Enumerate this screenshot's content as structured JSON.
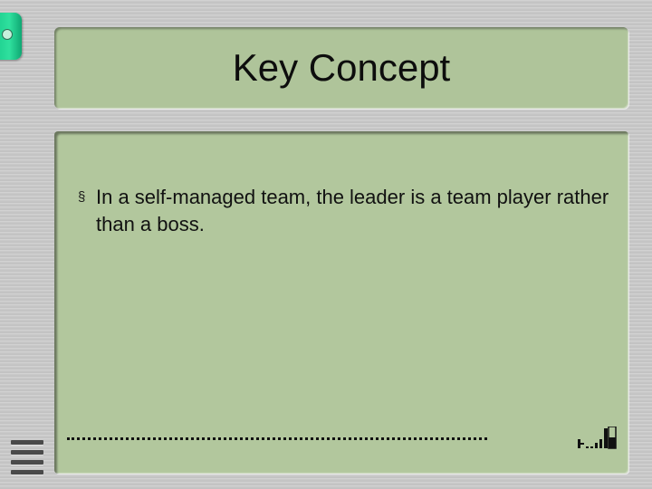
{
  "slide": {
    "title": "Key Concept",
    "bullets": [
      {
        "marker": "§",
        "text": "In a self-managed team, the leader is a team player rather than a boss."
      }
    ]
  },
  "icons": {
    "side_tab": "circle-tab-icon",
    "footer_signal": "signal-bars-icon",
    "menu": "menu-lines-icon"
  },
  "colors": {
    "panel": "#b2c79d",
    "background": "#c9c9c9",
    "tab": "#22d694"
  }
}
